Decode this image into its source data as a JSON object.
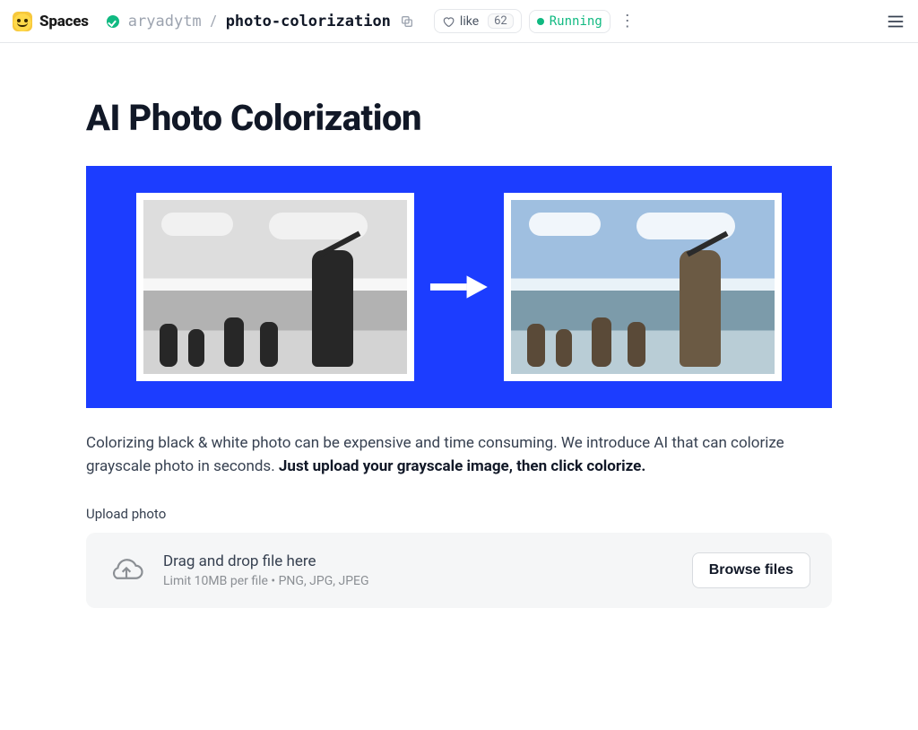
{
  "header": {
    "brand": "Spaces",
    "owner": "aryadytm",
    "separator": "/",
    "space_name": "photo-colorization",
    "like_label": "like",
    "like_count": "62",
    "status_label": "Running"
  },
  "page": {
    "title": "AI Photo Colorization",
    "description_plain": "Colorizing black & white photo can be expensive and time consuming. We introduce AI that can colorize grayscale photo in seconds. ",
    "description_bold": "Just upload your grayscale image, then click colorize."
  },
  "upload": {
    "label": "Upload photo",
    "dropzone_title": "Drag and drop file here",
    "dropzone_sub": "Limit 10MB per file • PNG, JPG, JPEG",
    "browse_label": "Browse files"
  }
}
